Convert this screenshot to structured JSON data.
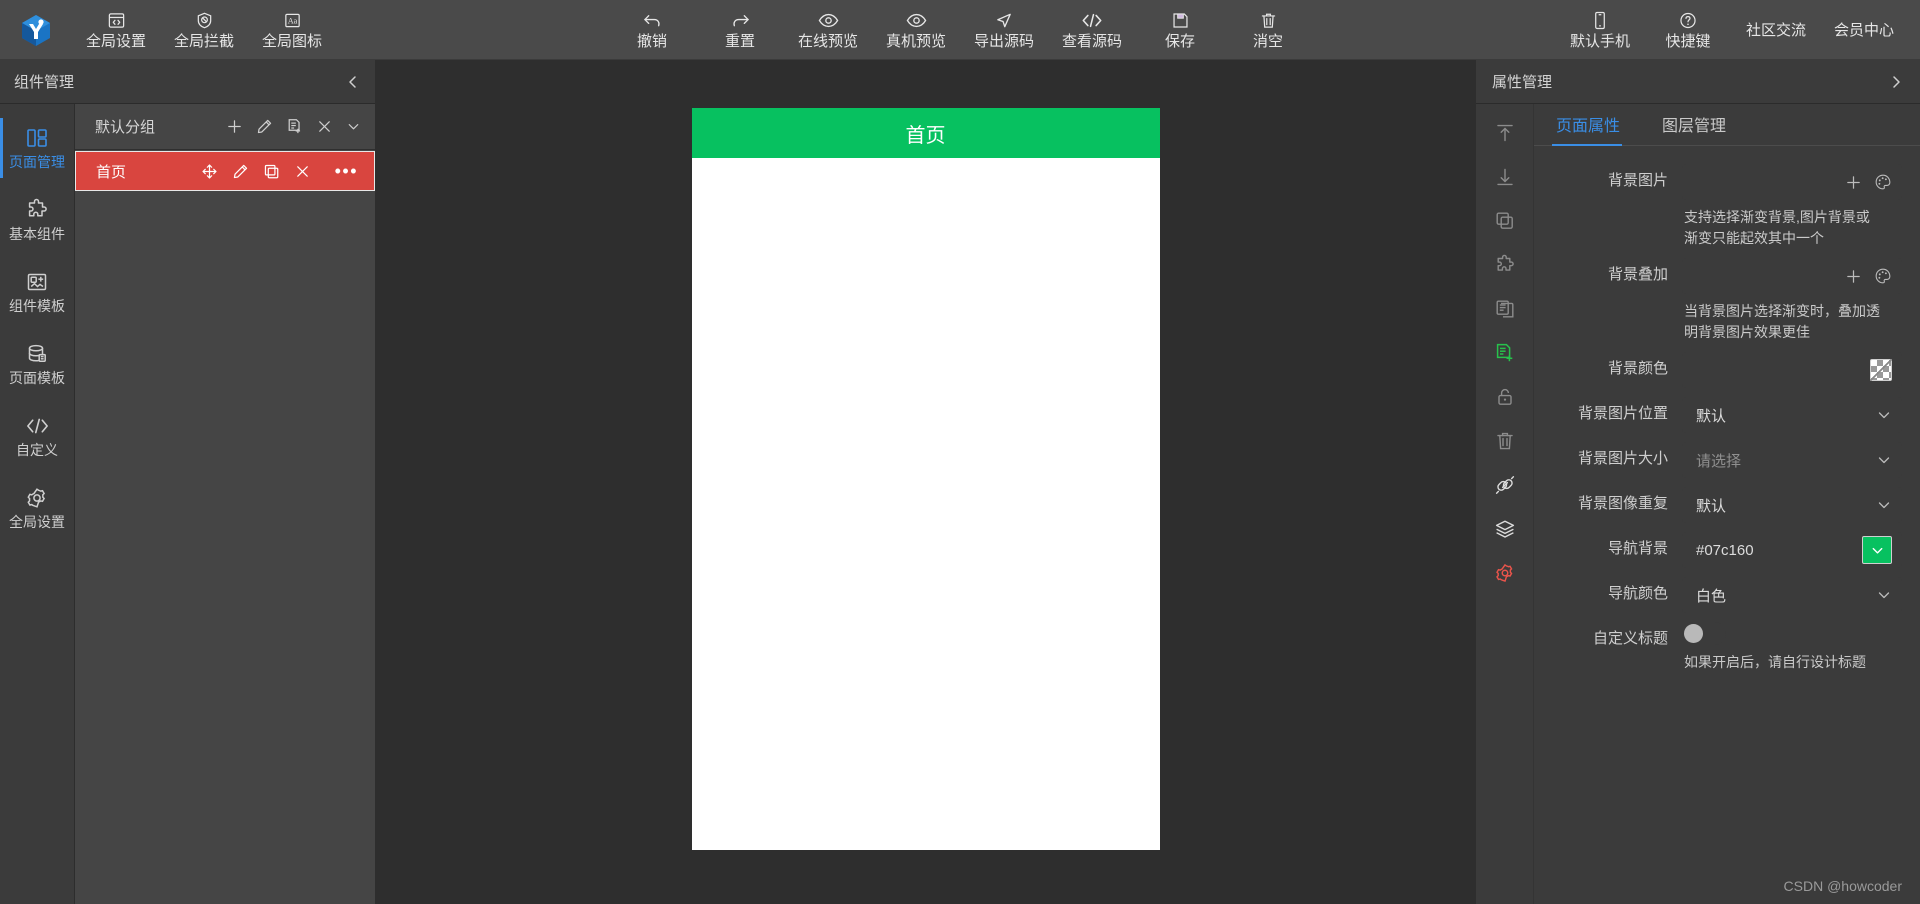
{
  "toolbar": {
    "logo_name": "app-logo",
    "left_items": [
      {
        "label": "全局设置",
        "icon": "code-window-icon"
      },
      {
        "label": "全局拦截",
        "icon": "shield-block-icon"
      },
      {
        "label": "全局图标",
        "icon": "text-image-icon"
      }
    ],
    "center_items": [
      {
        "label": "撤销",
        "icon": "undo-icon"
      },
      {
        "label": "重置",
        "icon": "redo-icon"
      },
      {
        "label": "在线预览",
        "icon": "eye-icon"
      },
      {
        "label": "真机预览",
        "icon": "eye-icon"
      },
      {
        "label": "导出源码",
        "icon": "send-icon"
      },
      {
        "label": "查看源码",
        "icon": "code-icon"
      },
      {
        "label": "保存",
        "icon": "save-icon"
      },
      {
        "label": "消空",
        "icon": "trash-icon"
      }
    ],
    "right_items": [
      {
        "label": "默认手机",
        "icon": "phone-icon"
      },
      {
        "label": "快捷键",
        "icon": "question-circle-icon"
      }
    ],
    "right_links": [
      "社区交流",
      "会员中心"
    ]
  },
  "left_panel": {
    "title": "组件管理",
    "collapse_icon": "chevron-left-icon",
    "rail_items": [
      {
        "label": "页面管理",
        "icon": "layout-icon",
        "active": true
      },
      {
        "label": "基本组件",
        "icon": "puzzle-icon",
        "active": false
      },
      {
        "label": "组件模板",
        "icon": "component-add-icon",
        "active": false
      },
      {
        "label": "页面模板",
        "icon": "database-icon",
        "active": false
      },
      {
        "label": "自定义",
        "icon": "code-icon",
        "active": false
      },
      {
        "label": "全局设置",
        "icon": "gear-icon",
        "active": false
      }
    ],
    "group": {
      "name": "默认分组",
      "actions": [
        {
          "icon": "plus-icon",
          "name": "add-group-button"
        },
        {
          "icon": "pencil-icon",
          "name": "edit-group-button"
        },
        {
          "icon": "file-add-icon",
          "name": "add-page-button"
        },
        {
          "icon": "close-icon",
          "name": "delete-group-button"
        },
        {
          "icon": "chevron-down-icon",
          "name": "collapse-group-button"
        }
      ]
    },
    "pages": [
      {
        "name": "首页",
        "selected": true,
        "actions": [
          {
            "icon": "move-icon",
            "name": "drag-page-handle"
          },
          {
            "icon": "pencil-icon",
            "name": "rename-page-button"
          },
          {
            "icon": "copy-icon",
            "name": "copy-page-button"
          },
          {
            "icon": "close-icon",
            "name": "delete-page-button"
          },
          {
            "icon": "more-icon",
            "name": "page-more-button"
          }
        ]
      }
    ]
  },
  "canvas": {
    "nav_title": "首页",
    "nav_bg": "#07c160",
    "nav_color": "#ffffff"
  },
  "right_panel": {
    "title": "属性管理",
    "expand_icon": "chevron-right-icon",
    "rail_items": [
      {
        "icon": "move-to-top-icon",
        "name": "move-to-top-button",
        "color": "#8c8c8c"
      },
      {
        "icon": "move-to-bottom-icon",
        "name": "move-to-bottom-button",
        "color": "#8c8c8c"
      },
      {
        "icon": "duplicate-icon",
        "name": "duplicate-button",
        "color": "#8c8c8c"
      },
      {
        "icon": "puzzle-icon",
        "name": "component-button",
        "color": "#8c8c8c"
      },
      {
        "icon": "copy-docs-icon",
        "name": "copy-docs-button",
        "color": "#8c8c8c"
      },
      {
        "icon": "file-add-icon",
        "name": "save-template-button",
        "color": "#27c24c"
      },
      {
        "icon": "unlock-icon",
        "name": "lock-button",
        "color": "#8c8c8c"
      },
      {
        "icon": "trash-icon",
        "name": "delete-button",
        "color": "#8c8c8c"
      },
      {
        "icon": "link-icon",
        "name": "link-button",
        "color": "#dcdcdc"
      },
      {
        "icon": "layers-icon",
        "name": "layers-button",
        "color": "#dcdcdc"
      },
      {
        "icon": "gear-icon",
        "name": "settings-button",
        "color": "#e8544b"
      }
    ],
    "tabs": [
      {
        "label": "页面属性",
        "active": true
      },
      {
        "label": "图层管理",
        "active": false
      }
    ],
    "fields": [
      {
        "label": "背景图片",
        "type": "picker",
        "value": "",
        "icons": [
          "plus-icon",
          "palette-icon"
        ],
        "hint": "支持选择渐变背景,图片背景或渐变只能起效其中一个"
      },
      {
        "label": "背景叠加",
        "type": "picker",
        "value": "",
        "icons": [
          "plus-icon",
          "palette-icon"
        ],
        "hint": "当背景图片选择渐变时，叠加透明背景图片效果更佳"
      },
      {
        "label": "背景颜色",
        "type": "color-transparent",
        "value": "",
        "hint": ""
      },
      {
        "label": "背景图片位置",
        "type": "select",
        "value": "默认",
        "hint": ""
      },
      {
        "label": "背景图片大小",
        "type": "select",
        "value": "请选择",
        "placeholder": true,
        "hint": ""
      },
      {
        "label": "背景图像重复",
        "type": "select",
        "value": "默认",
        "hint": ""
      },
      {
        "label": "导航背景",
        "type": "color-select",
        "value": "#07c160",
        "swatch": "#07c160",
        "hint": ""
      },
      {
        "label": "导航颜色",
        "type": "select",
        "value": "白色",
        "hint": ""
      },
      {
        "label": "自定义标题",
        "type": "toggle",
        "value": "off",
        "hint": "如果开启后，请自行设计标题"
      }
    ],
    "watermark": "CSDN @howcoder"
  }
}
